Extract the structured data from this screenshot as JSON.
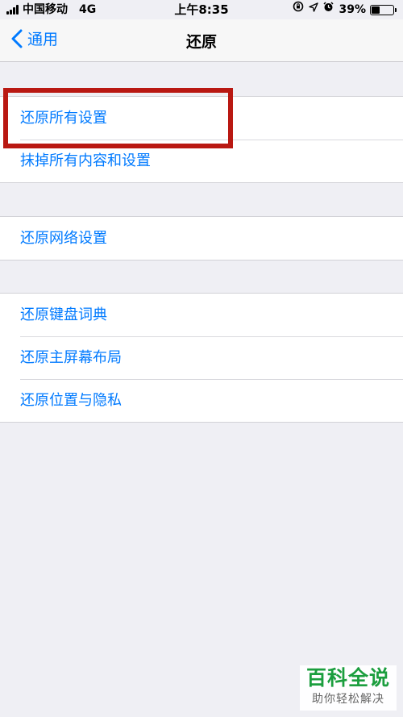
{
  "status_bar": {
    "carrier": "中国移动",
    "network": "4G",
    "time": "上午8:35",
    "battery_percent": "39%",
    "battery_level": 0.39,
    "icons": [
      "signal-icon",
      "lock-rotation-icon",
      "location-icon",
      "alarm-icon",
      "battery-icon"
    ]
  },
  "nav": {
    "back_label": "通用",
    "title": "还原"
  },
  "groups": [
    {
      "items": [
        "还原所有设置",
        "抹掉所有内容和设置"
      ]
    },
    {
      "items": [
        "还原网络设置"
      ]
    },
    {
      "items": [
        "还原键盘词典",
        "还原主屏幕布局",
        "还原位置与隐私"
      ]
    }
  ],
  "colors": {
    "accent": "#007aff",
    "background": "#efeff4",
    "highlight_box": "#b91812",
    "watermark_green": "#1b9e3e"
  },
  "watermark": {
    "title": "百科全说",
    "subtitle": "助你轻松解决"
  }
}
